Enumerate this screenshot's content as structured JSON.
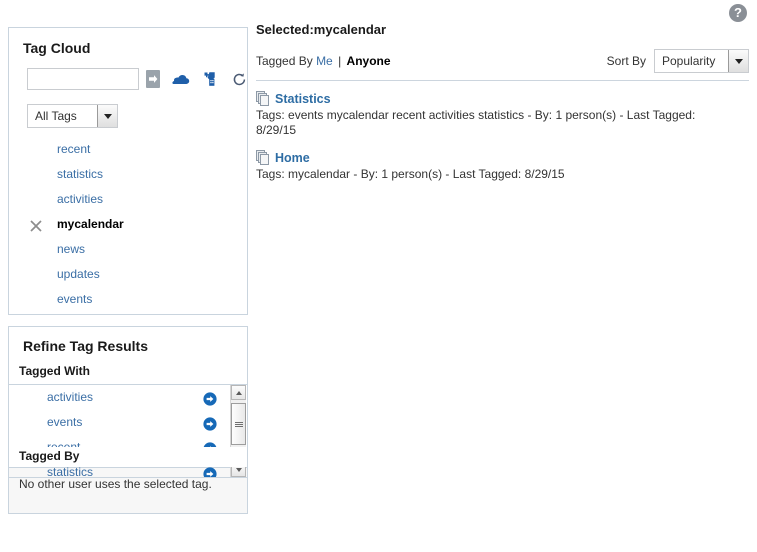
{
  "help": {
    "icon": "help-icon",
    "glyph": "?"
  },
  "tag_cloud": {
    "title": "Tag Cloud",
    "search": {
      "value": "",
      "placeholder": ""
    },
    "buttons": {
      "go": "go-arrow-icon",
      "cloud": "tag-cloud-icon",
      "add_tag": "add-tag-icon",
      "refresh": "refresh-icon"
    },
    "filter_select": {
      "value": "All Tags",
      "options": [
        "All Tags"
      ]
    },
    "tags": [
      {
        "label": "recent",
        "selected": false
      },
      {
        "label": "statistics",
        "selected": false
      },
      {
        "label": "activities",
        "selected": false
      },
      {
        "label": "mycalendar",
        "selected": true
      },
      {
        "label": "news",
        "selected": false
      },
      {
        "label": "updates",
        "selected": false
      },
      {
        "label": "events",
        "selected": false
      }
    ]
  },
  "refine": {
    "title": "Refine Tag Results",
    "tagged_with_label": "Tagged With",
    "tagged_with": [
      {
        "label": "activities"
      },
      {
        "label": "events"
      },
      {
        "label": "recent"
      },
      {
        "label": "statistics"
      }
    ],
    "tagged_by_label": "Tagged By",
    "no_user_message": "No other user uses the selected tag."
  },
  "main": {
    "selected_title": "Selected:mycalendar",
    "tagged_by": {
      "label": "Tagged By",
      "me": "Me",
      "separator": "|",
      "anyone": "Anyone"
    },
    "sort": {
      "label": "Sort By",
      "value": "Popularity",
      "options": [
        "Popularity"
      ]
    },
    "results": [
      {
        "title": "Statistics",
        "meta": "Tags: events mycalendar recent activities statistics - By: 1 person(s) - Last Tagged: 8/29/15"
      },
      {
        "title": "Home",
        "meta": "Tags: mycalendar - By: 1 person(s) - Last Tagged: 8/29/15"
      }
    ]
  },
  "colors": {
    "link": "#3a6ea5",
    "title_link": "#2e6da4",
    "panel_border": "#c9d4de",
    "accent_blue": "#1f5fa9",
    "help_gray": "#8a8f96"
  }
}
